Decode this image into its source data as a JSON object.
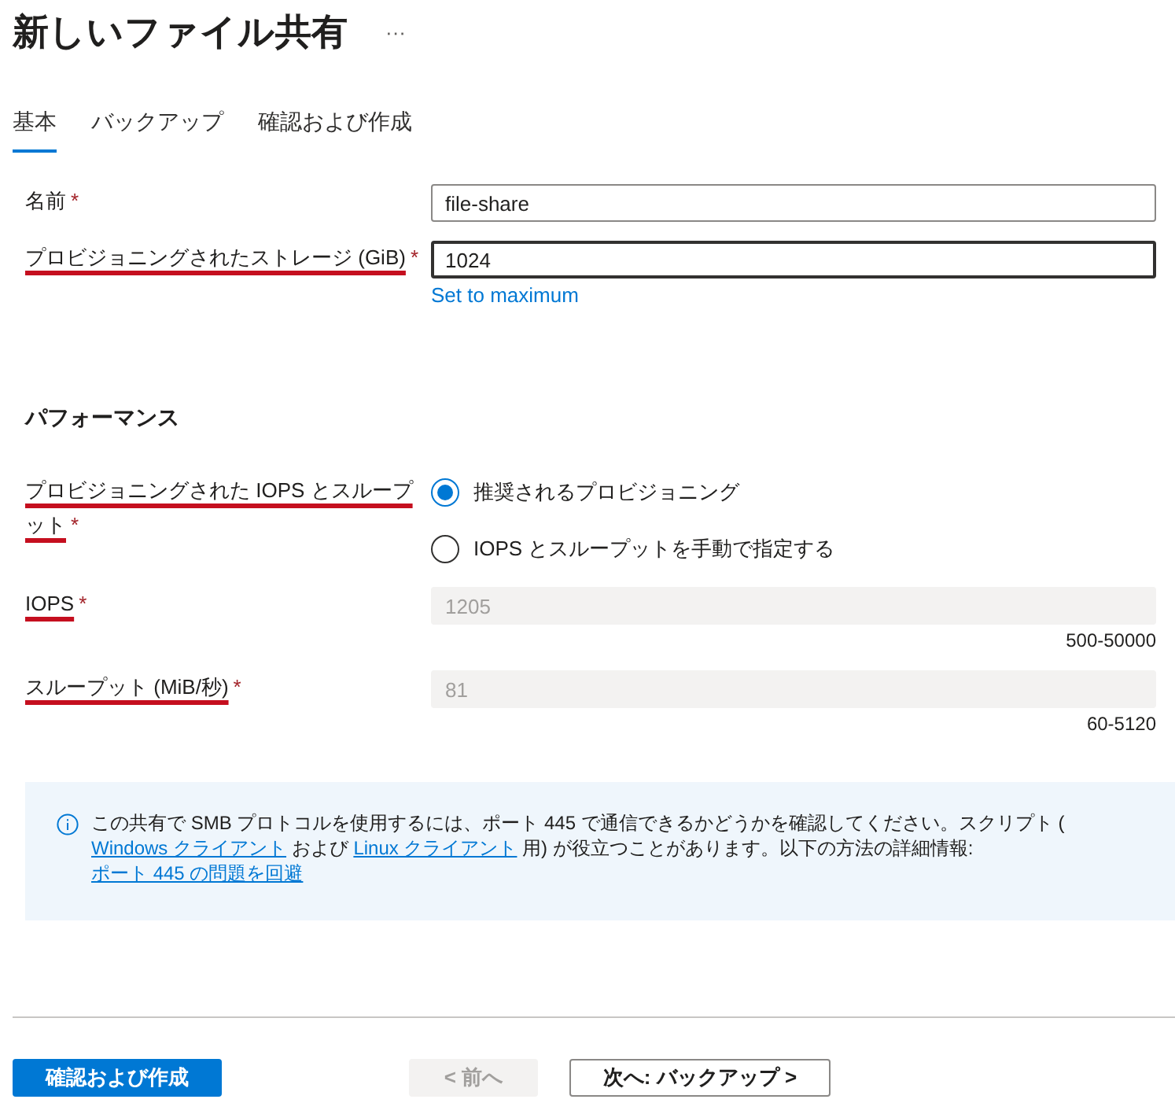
{
  "title": "新しいファイル共有",
  "more_button": "···",
  "tabs": [
    {
      "label": "基本",
      "selected": true
    },
    {
      "label": "バックアップ",
      "selected": false
    },
    {
      "label": "確認および作成",
      "selected": false
    }
  ],
  "basic_fields": [
    {
      "label": "名前",
      "required": "*",
      "underlined": false,
      "value": "file-share",
      "focused": false,
      "disabled": false
    },
    {
      "label": "プロビジョニングされたストレージ (GiB)",
      "required": "*",
      "underlined": true,
      "value": "1024",
      "focused": true,
      "disabled": false,
      "link": "Set to maximum"
    }
  ],
  "performance": {
    "heading": "パフォーマンス",
    "provisioning": {
      "label": "プロビジョニングされた IOPS とスループット",
      "required": "*",
      "underlined": true,
      "options": [
        {
          "label": "推奨されるプロビジョニング",
          "selected": true
        },
        {
          "label": "IOPS とスループットを手動で指定する",
          "selected": false
        }
      ]
    },
    "fields": [
      {
        "label": "IOPS",
        "required": "*",
        "underlined": true,
        "value": "1205",
        "disabled": true,
        "range": "500-50000"
      },
      {
        "label": "スループット (MiB/秒)",
        "required": "*",
        "underlined": true,
        "value": "81",
        "disabled": true,
        "range": "60-5120"
      }
    ]
  },
  "info": {
    "segments": [
      {
        "kind": "text",
        "text": "この共有で SMB プロトコルを使用するには、ポート 445 で通信できるかどうかを確認してください。スクリプト ( "
      },
      {
        "kind": "link",
        "text": "Windows クライアント"
      },
      {
        "kind": "text",
        "text": " および  "
      },
      {
        "kind": "link",
        "text": "Linux クライアント"
      },
      {
        "kind": "text",
        "text": " 用) が役立つことがあります。以下の方法の詳細情報:  "
      },
      {
        "kind": "link",
        "text": "ポート 445 の問題を回避"
      }
    ]
  },
  "footer": {
    "buttons": [
      {
        "label": "確認および作成",
        "kind": "primary",
        "disabled": false
      },
      {
        "label": "< 前へ",
        "kind": "secondary",
        "disabled": true
      },
      {
        "label": "次へ: バックアップ >",
        "kind": "secondary",
        "disabled": false
      }
    ]
  }
}
